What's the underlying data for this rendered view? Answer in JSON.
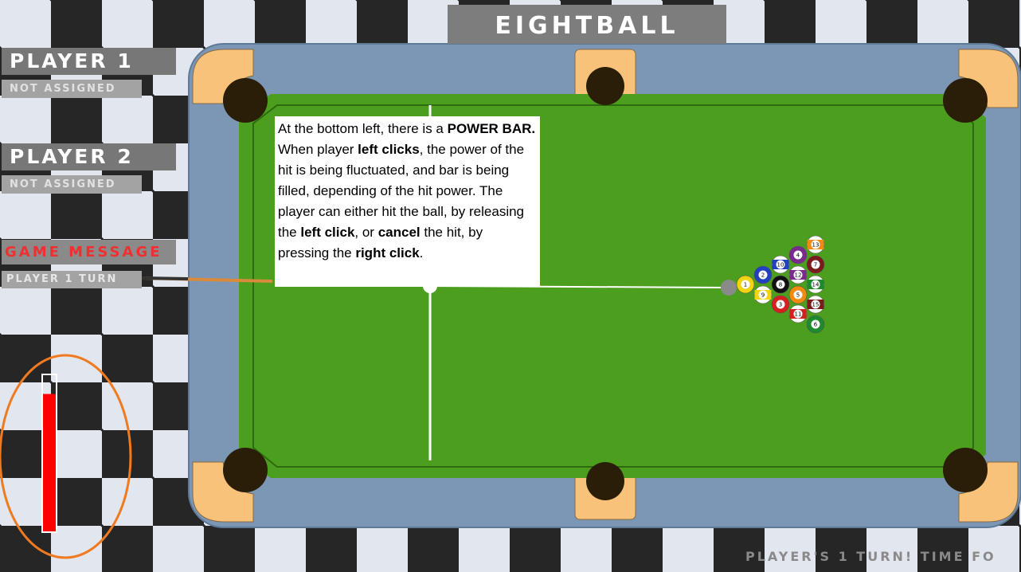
{
  "header": {
    "title": "EIGHTBALL"
  },
  "players": [
    {
      "name": "PLAYER 1",
      "status": "NOT ASSIGNED"
    },
    {
      "name": "PLAYER 2",
      "status": "NOT ASSIGNED"
    }
  ],
  "game_message": {
    "title": "GAME MESSAGE",
    "text": "PLAYER 1 TURN"
  },
  "status_bar": {
    "text": "PLAYER'S 1 TURN! TIME FO"
  },
  "power_bar": {
    "fill_fraction": 0.88,
    "color": "#ff0000"
  },
  "tooltip": {
    "segments": [
      {
        "text": "At the bottom left, there is a ",
        "bold": false
      },
      {
        "text": "POWER BAR.",
        "bold": true
      },
      {
        "text": " When player ",
        "bold": false
      },
      {
        "text": "left clicks",
        "bold": true
      },
      {
        "text": ", the power of the hit is being fluctuated, and bar is being filled, depending of the hit power. The player can either hit the ball, by releasing the ",
        "bold": false
      },
      {
        "text": "left click",
        "bold": true
      },
      {
        "text": ", or ",
        "bold": false
      },
      {
        "text": "cancel",
        "bold": true
      },
      {
        "text": " the hit, by pressing the ",
        "bold": false
      },
      {
        "text": "right click",
        "bold": true
      },
      {
        "text": ".",
        "bold": false
      }
    ]
  },
  "balls": [
    {
      "number": "1",
      "color": "#f2d40e",
      "stripe": false
    },
    {
      "number": "2",
      "color": "#2040c0",
      "stripe": false
    },
    {
      "number": "3",
      "color": "#d62020",
      "stripe": false
    },
    {
      "number": "4",
      "color": "#7a2a8c",
      "stripe": false
    },
    {
      "number": "5",
      "color": "#f08a10",
      "stripe": false
    },
    {
      "number": "6",
      "color": "#1e8a2e",
      "stripe": false
    },
    {
      "number": "7",
      "color": "#7a1c1c",
      "stripe": false
    },
    {
      "number": "8",
      "color": "#111111",
      "stripe": false
    },
    {
      "number": "9",
      "color": "#f2d40e",
      "stripe": true
    },
    {
      "number": "10",
      "color": "#2040c0",
      "stripe": true
    },
    {
      "number": "11",
      "color": "#d62020",
      "stripe": true
    },
    {
      "number": "12",
      "color": "#7a2a8c",
      "stripe": true
    },
    {
      "number": "13",
      "color": "#f08a10",
      "stripe": true
    },
    {
      "number": "14",
      "color": "#1e8a2e",
      "stripe": true
    },
    {
      "number": "15",
      "color": "#7a1c1c",
      "stripe": true
    }
  ],
  "colors": {
    "felt": "#4c9e1e",
    "rail": "#7b97b5",
    "pocket": "#2a1e08",
    "pocket_guard": "#f8c27a",
    "cue_ball": "#8a8a8a",
    "highlight_ring": "#f07a20"
  }
}
